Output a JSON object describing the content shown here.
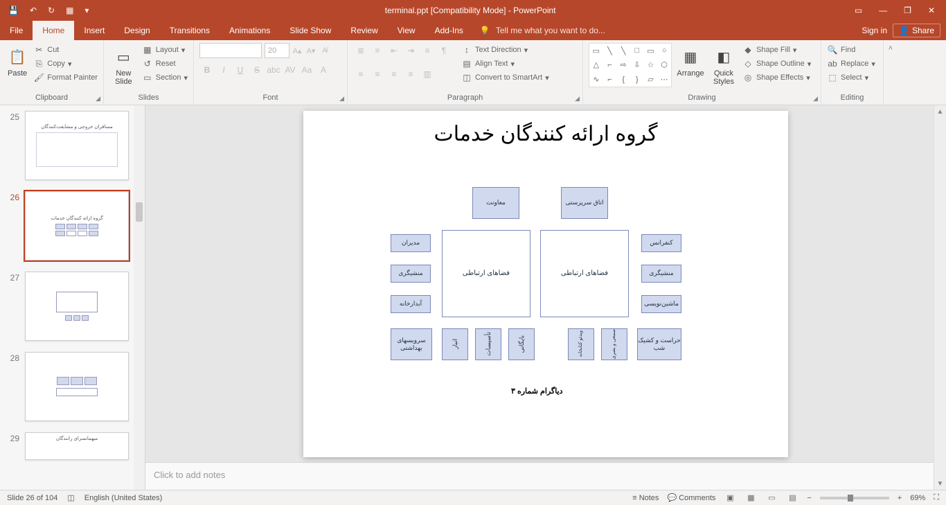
{
  "app": {
    "title": "terminal.ppt [Compatibility Mode] - PowerPoint"
  },
  "qat": {
    "save": "💾",
    "undo": "↶",
    "redo": "↻",
    "start": "▦",
    "more": "▾"
  },
  "winctl": {
    "display": "▭",
    "min": "―",
    "restore": "❐",
    "close": "✕"
  },
  "tabs": {
    "file": "File",
    "home": "Home",
    "insert": "Insert",
    "design": "Design",
    "transitions": "Transitions",
    "animations": "Animations",
    "slideshow": "Slide Show",
    "review": "Review",
    "view": "View",
    "addins": "Add-Ins",
    "tell": "Tell me what you want to do...",
    "signin": "Sign in",
    "share": "Share"
  },
  "ribbon": {
    "clipboard": {
      "label": "Clipboard",
      "paste": "Paste",
      "cut": "Cut",
      "copy": "Copy",
      "format_painter": "Format Painter"
    },
    "slides": {
      "label": "Slides",
      "new_slide": "New\nSlide",
      "layout": "Layout",
      "reset": "Reset",
      "section": "Section"
    },
    "font": {
      "label": "Font",
      "size_value": "20",
      "bold": "B",
      "italic": "I",
      "underline": "U",
      "strike": "S",
      "shadow": "abc",
      "spacing": "AV",
      "case": "Aa",
      "color": "A"
    },
    "paragraph": {
      "label": "Paragraph",
      "text_direction": "Text Direction",
      "align_text": "Align Text",
      "smart_art": "Convert to SmartArt"
    },
    "drawing": {
      "label": "Drawing",
      "arrange": "Arrange",
      "quick_styles": "Quick\nStyles",
      "shape_fill": "Shape Fill",
      "shape_outline": "Shape Outline",
      "shape_effects": "Shape Effects"
    },
    "editing": {
      "label": "Editing",
      "find": "Find",
      "replace": "Replace",
      "select": "Select"
    }
  },
  "thumbs": {
    "s25": {
      "num": "25",
      "title": "مسافران خروجی و مشایعت‌کنندگان"
    },
    "s26": {
      "num": "26",
      "title": "گروه ارائه کنندگان خدمات"
    },
    "s27": {
      "num": "27",
      "title": ""
    },
    "s28": {
      "num": "28",
      "title": ""
    },
    "s29": {
      "num": "29",
      "title": "میهمانسرای رانندگان"
    }
  },
  "slide": {
    "title": "گروه ارائه کنندگان خدمات",
    "top1": "معاونت",
    "top2": "اتاق سرپرستی",
    "left1": "مدیران",
    "left2": "منشیگری",
    "left3": "آبدارخانه",
    "center1": "فضاهای ارتباطی",
    "center2": "فضاهای ارتباطی",
    "right1": "کنفرانس",
    "right2": "منشیگری",
    "right3": "ماشین‌نویسی",
    "bottom1": "سرویسهای بهداشتی",
    "bottom2": "انبار",
    "bottom3": "تأسیسات",
    "bottom4": "بایگانی",
    "bottom5": "ویدئو کتابخانه",
    "bottom6": "سمعی و بصری",
    "bottom7": "حراست و کشیک شب",
    "caption": "دیاگرام شماره ۳"
  },
  "notes": {
    "placeholder": "Click to add notes"
  },
  "status": {
    "slide_pos": "Slide 26 of 104",
    "lang": "English (United States)",
    "notes": "Notes",
    "comments": "Comments",
    "zoom": "69%"
  }
}
